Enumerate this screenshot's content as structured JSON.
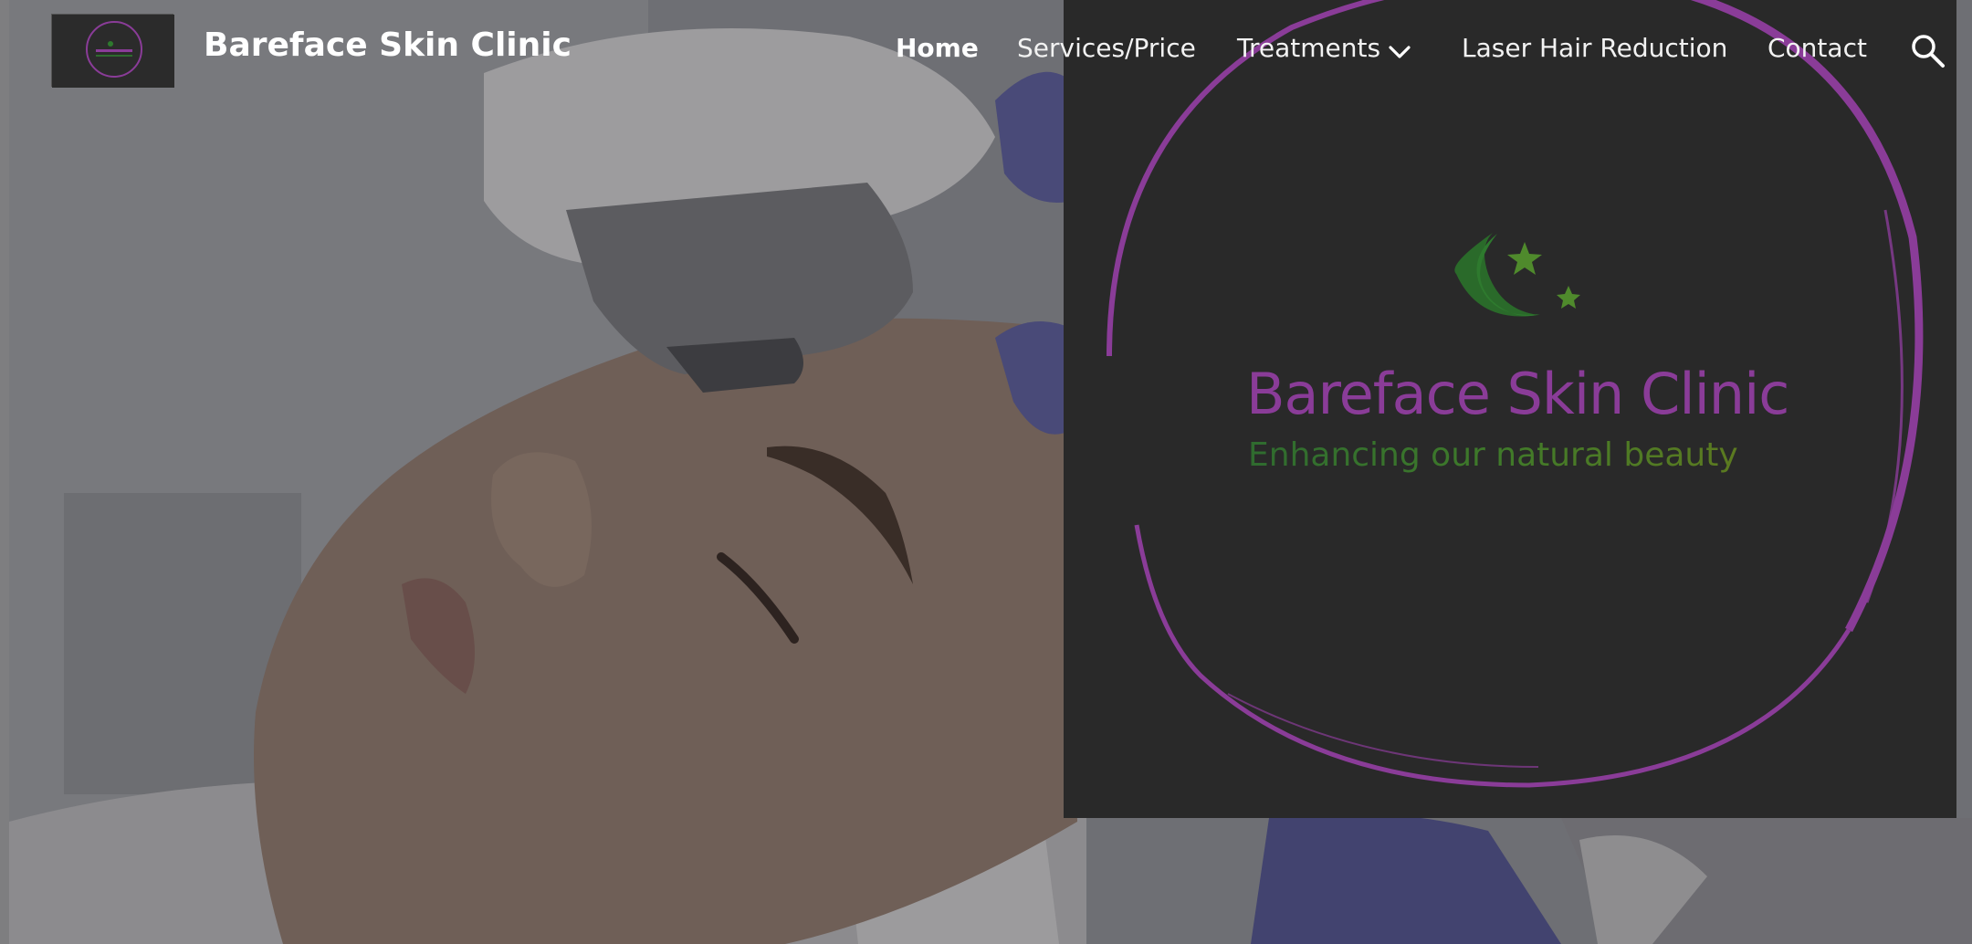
{
  "header": {
    "site_title": "Bareface Skin Clinic",
    "logo_thumb_icon": "site-logo-thumbnail"
  },
  "nav": {
    "items": [
      {
        "label": "Home",
        "active": true
      },
      {
        "label": "Services/Price",
        "active": false
      },
      {
        "label": "Treatments",
        "active": false,
        "has_dropdown": true,
        "dropdown_icon": "chevron-down-icon"
      },
      {
        "label": "Laser Hair Reduction",
        "active": false
      },
      {
        "label": "Contact",
        "active": false
      }
    ],
    "search_icon": "search-icon"
  },
  "hero": {
    "image": "woman-receiving-skin-treatment-photo"
  },
  "logo": {
    "title": "Bareface Skin Clinic",
    "tagline": "Enhancing our natural beauty",
    "icon": "moon-and-stars-icon"
  },
  "colors": {
    "logo_purple": "#8a3c98",
    "logo_green": "#2f6b2f",
    "panel_bg": "#292929",
    "nav_text": "#ffffff"
  }
}
